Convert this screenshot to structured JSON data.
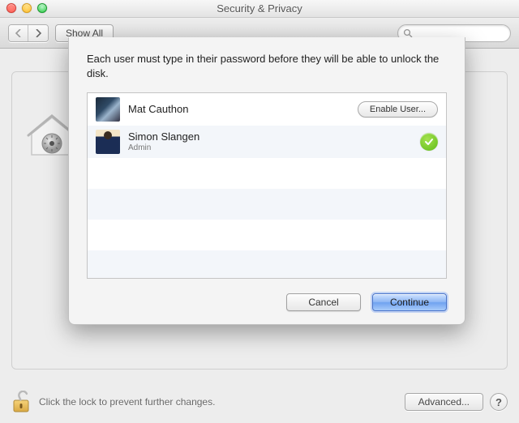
{
  "window": {
    "title": "Security & Privacy"
  },
  "toolbar": {
    "show_all": "Show All",
    "search_placeholder": ""
  },
  "sheet": {
    "message": "Each user must type in their password before they will be able to unlock the disk.",
    "users": [
      {
        "name": "Mat Cauthon",
        "subtitle": "",
        "action_label": "Enable User...",
        "enabled": false
      },
      {
        "name": "Simon Slangen",
        "subtitle": "Admin",
        "action_label": "",
        "enabled": true
      }
    ],
    "cancel": "Cancel",
    "continue": "Continue"
  },
  "footer": {
    "lock_text": "Click the lock to prevent further changes.",
    "advanced": "Advanced...",
    "help": "?"
  }
}
